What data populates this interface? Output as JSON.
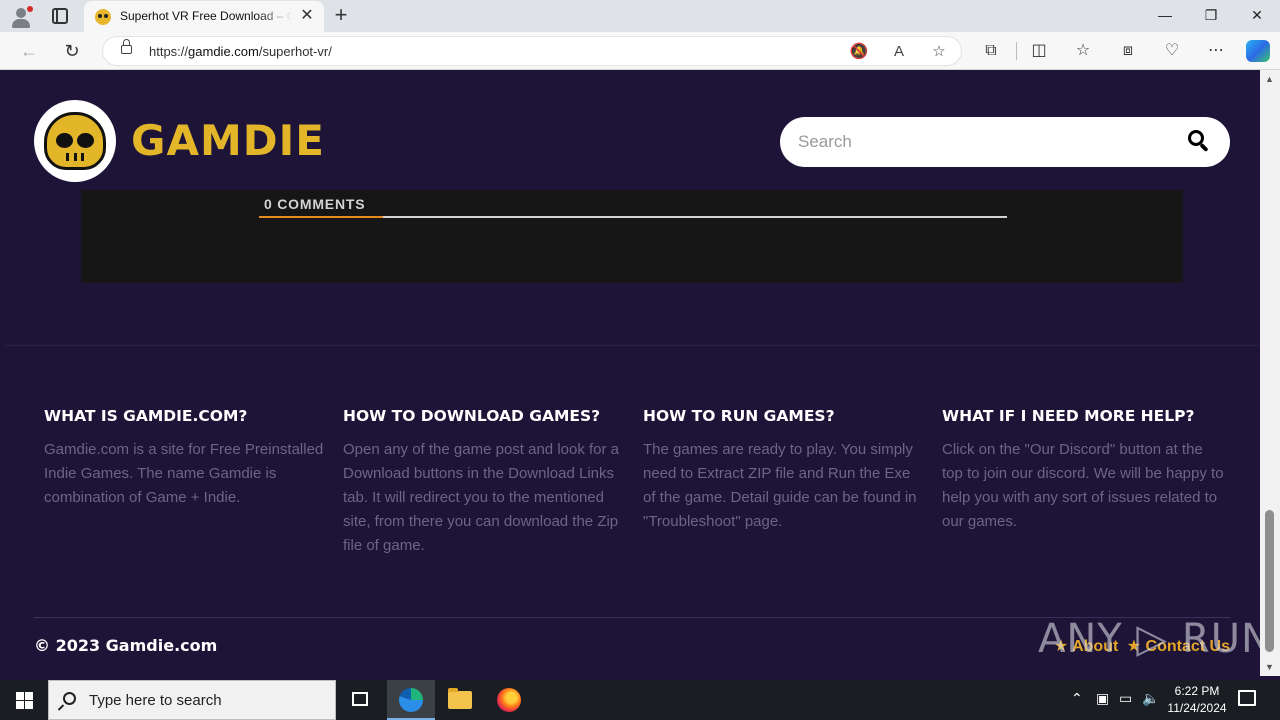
{
  "browser": {
    "tab_title": "Superhot VR Free Download – Gamdie",
    "tab_close": "✕",
    "new_tab": "+",
    "url_scheme": "https://",
    "url_host": "gamdie.com",
    "url_path": "/superhot-vr/",
    "window_minimize": "—",
    "window_restore": "❐",
    "window_close": "✕"
  },
  "site": {
    "logo_text": "GAMDIE",
    "search_placeholder": "Search",
    "comments_title": "0 COMMENTS",
    "accent_color": "#e3b529"
  },
  "footer": {
    "columns": [
      {
        "heading": "WHAT IS GAMDIE.COM?",
        "text": "Gamdie.com is a site for Free Preinstalled Indie Games. The name Gamdie is combination of Game + Indie."
      },
      {
        "heading": "HOW TO DOWNLOAD GAMES?",
        "text": "Open any of the game post and look for a Download buttons in the Download Links tab. It will redirect you to the mentioned site, from there you can download the Zip file of game."
      },
      {
        "heading": "HOW TO RUN GAMES?",
        "text": "The games are ready to play. You simply need to Extract ZIP file and Run the Exe of the game. Detail guide can be found in \"Troubleshoot\" page."
      },
      {
        "heading": "WHAT IF I NEED MORE HELP?",
        "text": "Click on the \"Our Discord\" button at the top to join our discord. We will be happy to help you with any sort of issues related to our games."
      }
    ],
    "copyright": "© 2023 Gamdie.com",
    "links": [
      "★ About",
      "★ Contact Us"
    ]
  },
  "watermark": "ANY ▷ RUN",
  "taskbar": {
    "search_placeholder": "Type here to search",
    "time": "6:22 PM",
    "date": "11/24/2024"
  }
}
